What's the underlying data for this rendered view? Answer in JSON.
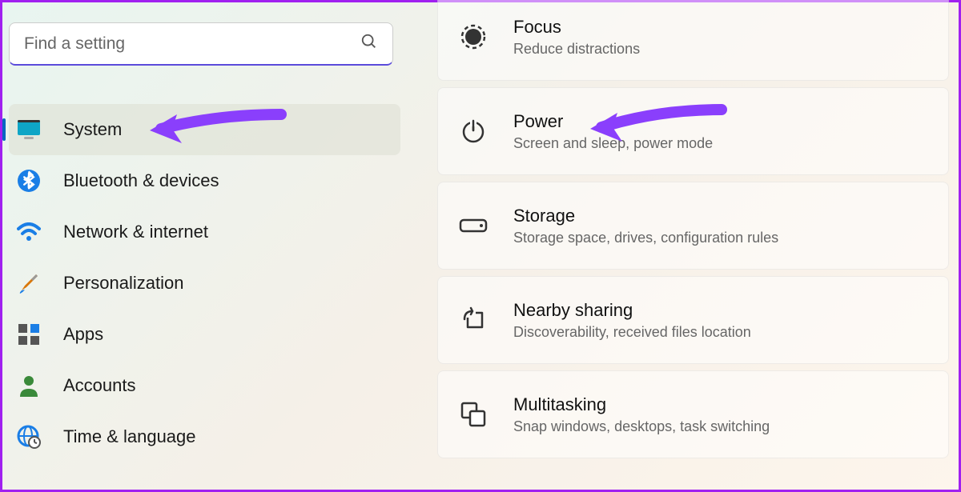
{
  "search": {
    "placeholder": "Find a setting"
  },
  "sidebar": {
    "items": [
      {
        "label": "System"
      },
      {
        "label": "Bluetooth & devices"
      },
      {
        "label": "Network & internet"
      },
      {
        "label": "Personalization"
      },
      {
        "label": "Apps"
      },
      {
        "label": "Accounts"
      },
      {
        "label": "Time & language"
      }
    ]
  },
  "main": {
    "cards": [
      {
        "title": "Focus",
        "sub": "Reduce distractions"
      },
      {
        "title": "Power",
        "sub": "Screen and sleep, power mode"
      },
      {
        "title": "Storage",
        "sub": "Storage space, drives, configuration rules"
      },
      {
        "title": "Nearby sharing",
        "sub": "Discoverability, received files location"
      },
      {
        "title": "Multitasking",
        "sub": "Snap windows, desktops, task switching"
      }
    ]
  }
}
